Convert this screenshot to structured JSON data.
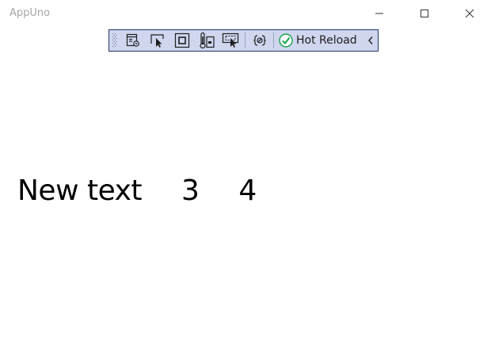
{
  "window": {
    "title": "AppUno"
  },
  "toolbar": {
    "buttons": [
      {
        "name": "live-visual-tree-icon"
      },
      {
        "name": "select-element-icon"
      },
      {
        "name": "display-layout-adorners-icon"
      },
      {
        "name": "track-focused-element-icon"
      },
      {
        "name": "preview-selection-icon"
      },
      {
        "name": "binding-failures-icon"
      }
    ],
    "hot_reload_label": "Hot Reload",
    "hot_reload_status_color": "#16a34a"
  },
  "content": {
    "text1": "New text",
    "text2": "3",
    "text3": "4"
  }
}
